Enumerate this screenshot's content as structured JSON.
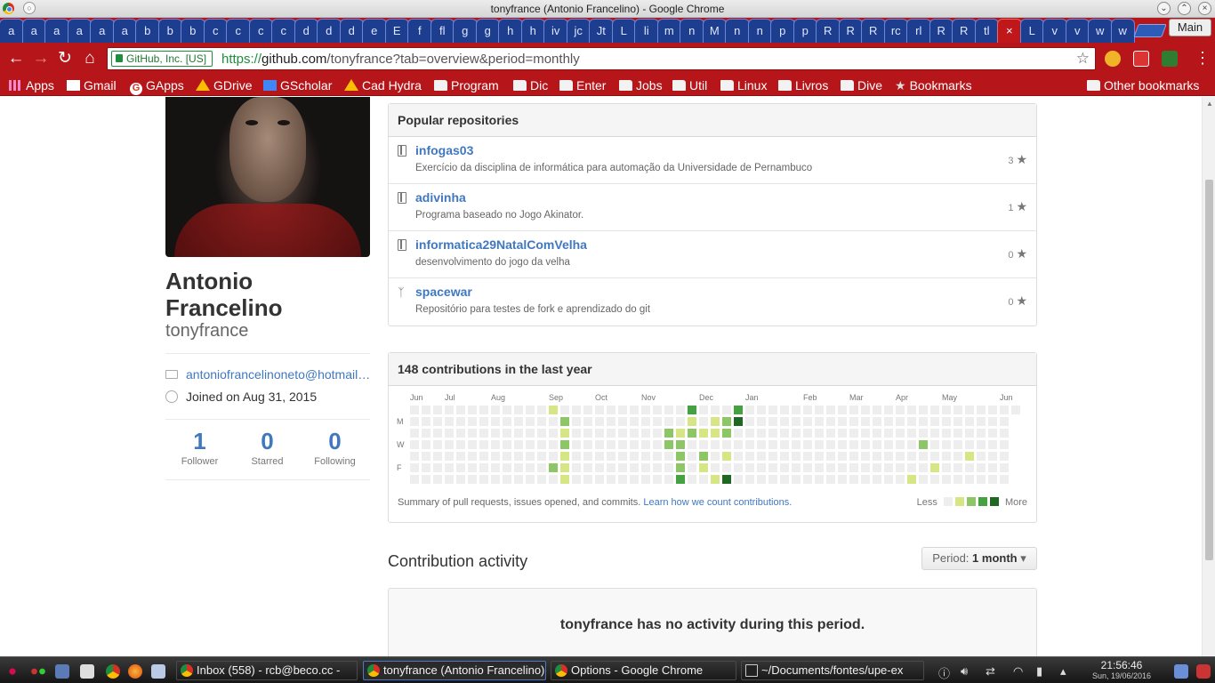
{
  "window": {
    "title": "tonyfrance (Antonio Francelino) - Google Chrome",
    "main_label": "Main"
  },
  "tabs": [
    "a",
    "a",
    "a",
    "a",
    "a",
    "a",
    "b",
    "b",
    "b",
    "c",
    "c",
    "c",
    "c",
    "d",
    "d",
    "d",
    "e",
    "E",
    "f",
    "fl",
    "g",
    "g",
    "h",
    "h",
    "iv",
    "jc",
    "Jt",
    "L",
    "li",
    "m",
    "n",
    "M",
    "n",
    "n",
    "p",
    "p",
    "R",
    "R",
    "R",
    "rc",
    "rl",
    "R",
    "R",
    "tl",
    "×",
    "L",
    "v",
    "v",
    "w",
    "w"
  ],
  "omnibox": {
    "ev_label": "GitHub, Inc. [US]",
    "scheme": "https://",
    "host": "github.com",
    "path": "/tonyfrance?tab=overview&period=monthly"
  },
  "bookmarks": {
    "items": [
      "Apps",
      "Gmail",
      "GApps",
      "GDrive",
      "GScholar",
      "Cad Hydra",
      "Program",
      "Dic",
      "Enter",
      "Jobs",
      "Util",
      "Linux",
      "Livros",
      "Dive",
      "Bookmarks"
    ],
    "other": "Other bookmarks"
  },
  "profile": {
    "full_name": "Antonio Francelino",
    "username": "tonyfrance",
    "email": "antoniofrancelinoneto@hotmail.com",
    "joined": "Joined on Aug 31, 2015",
    "stats": [
      {
        "count": "1",
        "label": "Follower"
      },
      {
        "count": "0",
        "label": "Starred"
      },
      {
        "count": "0",
        "label": "Following"
      }
    ]
  },
  "popular": {
    "header": "Popular repositories",
    "repos": [
      {
        "name": "infogas03",
        "desc": "Exercício da disciplina de informática para automação da Universidade de Pernambuco",
        "stars": "3",
        "icon": "repo-icon"
      },
      {
        "name": "adivinha",
        "desc": "Programa baseado no Jogo Akinator.",
        "stars": "1",
        "icon": "repo-icon"
      },
      {
        "name": "informatica29NatalComVelha",
        "desc": "desenvolvimento do jogo da velha",
        "stars": "0",
        "icon": "repo-icon"
      },
      {
        "name": "spacewar",
        "desc": "Repositório para testes de fork e aprendizado do git",
        "stars": "0",
        "icon": "fork-icon"
      }
    ]
  },
  "contributions": {
    "header": "148 contributions in the last year",
    "months": [
      "Jun",
      "Jul",
      "Aug",
      "Sep",
      "Oct",
      "Nov",
      "Dec",
      "Jan",
      "Feb",
      "Mar",
      "Apr",
      "May",
      "Jun"
    ],
    "month_weeks": [
      0,
      3,
      7,
      12,
      16,
      20,
      25,
      29,
      34,
      38,
      42,
      46,
      51
    ],
    "day_labels": [
      "M",
      "W",
      "F"
    ],
    "footer_text": "Summary of pull requests, issues opened, and commits.",
    "footer_link": "Learn how we count contributions.",
    "legend_less": "Less",
    "legend_more": "More",
    "colors": [
      "#eeeeee",
      "#d6e685",
      "#8cc665",
      "#44a340",
      "#1e6823"
    ],
    "weeks": 53,
    "active_cells": [
      {
        "w": 12,
        "d": 0,
        "l": 1
      },
      {
        "w": 12,
        "d": 5,
        "l": 2
      },
      {
        "w": 13,
        "d": 1,
        "l": 2
      },
      {
        "w": 13,
        "d": 2,
        "l": 1
      },
      {
        "w": 13,
        "d": 3,
        "l": 2
      },
      {
        "w": 13,
        "d": 4,
        "l": 1
      },
      {
        "w": 13,
        "d": 5,
        "l": 1
      },
      {
        "w": 13,
        "d": 6,
        "l": 1
      },
      {
        "w": 22,
        "d": 2,
        "l": 2
      },
      {
        "w": 22,
        "d": 3,
        "l": 2
      },
      {
        "w": 23,
        "d": 2,
        "l": 1
      },
      {
        "w": 23,
        "d": 3,
        "l": 2
      },
      {
        "w": 23,
        "d": 4,
        "l": 2
      },
      {
        "w": 23,
        "d": 5,
        "l": 2
      },
      {
        "w": 23,
        "d": 6,
        "l": 3
      },
      {
        "w": 24,
        "d": 0,
        "l": 3
      },
      {
        "w": 24,
        "d": 1,
        "l": 1
      },
      {
        "w": 24,
        "d": 2,
        "l": 2
      },
      {
        "w": 25,
        "d": 2,
        "l": 1
      },
      {
        "w": 25,
        "d": 4,
        "l": 2
      },
      {
        "w": 25,
        "d": 5,
        "l": 1
      },
      {
        "w": 26,
        "d": 1,
        "l": 1
      },
      {
        "w": 26,
        "d": 2,
        "l": 1
      },
      {
        "w": 26,
        "d": 6,
        "l": 1
      },
      {
        "w": 27,
        "d": 1,
        "l": 2
      },
      {
        "w": 27,
        "d": 2,
        "l": 2
      },
      {
        "w": 27,
        "d": 4,
        "l": 1
      },
      {
        "w": 27,
        "d": 6,
        "l": 4
      },
      {
        "w": 28,
        "d": 0,
        "l": 3
      },
      {
        "w": 28,
        "d": 1,
        "l": 4
      },
      {
        "w": 43,
        "d": 6,
        "l": 1
      },
      {
        "w": 44,
        "d": 3,
        "l": 2
      },
      {
        "w": 45,
        "d": 5,
        "l": 1
      },
      {
        "w": 48,
        "d": 4,
        "l": 1
      }
    ]
  },
  "activity": {
    "title": "Contribution activity",
    "period_label": "Period:",
    "period_value": "1 month",
    "empty": "tonyfrance has no activity during this period."
  },
  "taskbar": {
    "tasks": [
      {
        "label": "Inbox (558) - rcb@beco.cc -",
        "active": false
      },
      {
        "label": "tonyfrance (Antonio Francelino)",
        "active": true
      },
      {
        "label": "Options - Google Chrome",
        "active": false
      },
      {
        "label": "~/Documents/fontes/upe-ex",
        "active": false
      }
    ],
    "time": "21:56:46",
    "date": "Sun, 19/06/2016"
  }
}
